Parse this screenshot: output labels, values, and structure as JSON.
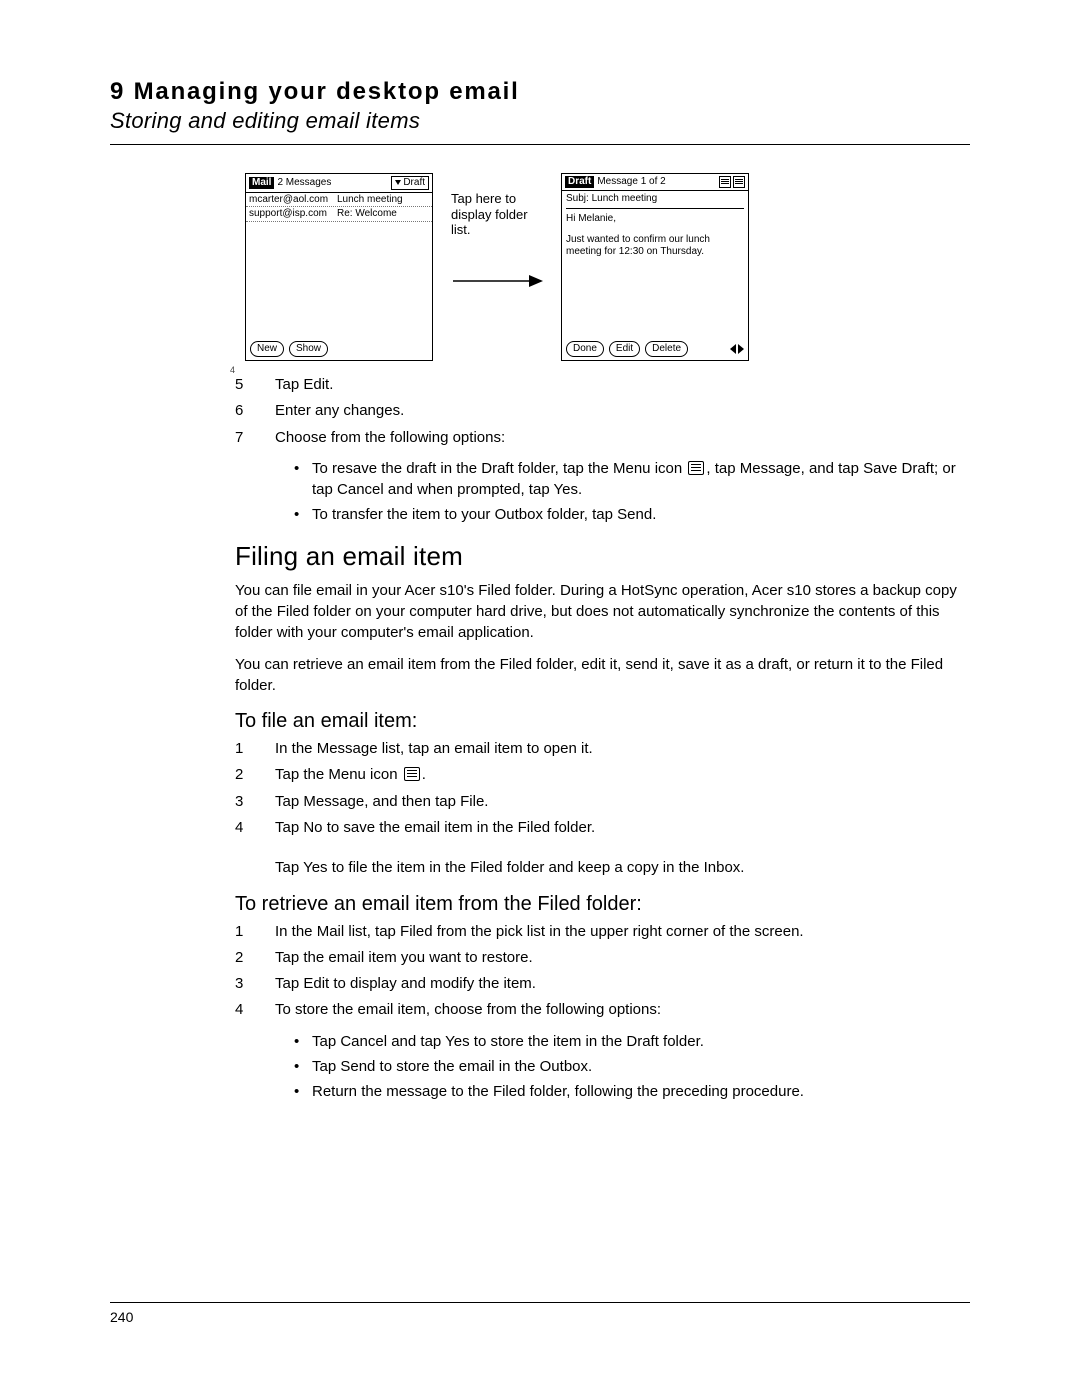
{
  "header": {
    "chapter_number": "9",
    "chapter_title": "Managing your desktop email",
    "section_subtitle": "Storing and editing email items"
  },
  "figure": {
    "callout": "Tap here to display folder list.",
    "left_screen": {
      "app_label": "Mail",
      "messages_count": "2 Messages",
      "folder_selector": "Draft",
      "row1_addr": "mcarter@aol.com",
      "row1_subj": "Lunch meeting",
      "row2_addr": "support@isp.com",
      "row2_subj": "Re: Welcome",
      "btn_new": "New",
      "btn_show": "Show"
    },
    "right_screen": {
      "app_label": "Draft",
      "count": "Message 1 of 2",
      "subj_label": "Subj:",
      "subj_value": "Lunch meeting",
      "greeting": "Hi Melanie,",
      "body": "Just wanted to confirm our lunch meeting for 12:30 on Thursday.",
      "btn_done": "Done",
      "btn_edit": "Edit",
      "btn_delete": "Delete"
    },
    "marker": "4"
  },
  "steps_top": {
    "s5": {
      "n": "5",
      "t": "Tap Edit."
    },
    "s6": {
      "n": "6",
      "t": "Enter any changes."
    },
    "s7": {
      "n": "7",
      "t": "Choose from the following options:"
    }
  },
  "bullets_top": {
    "b1": "To resave the draft in the Draft folder, tap the Menu icon , tap Message, and tap Save Draft; or tap Cancel and when prompted, tap Yes.",
    "b2": "To transfer the item to your Outbox folder, tap Send."
  },
  "section_filing": {
    "title": "Filing an email item",
    "p1": "You can file email in your Acer s10's Filed folder. During a HotSync operation, Acer s10 stores a backup copy of the Filed folder on your computer hard drive, but does not automatically synchronize the contents of this folder with your computer's email application.",
    "p2": "You can retrieve an email item from the Filed folder, edit it, send it, save it as a draft, or return it to the Filed folder."
  },
  "to_file": {
    "title": "To file an email item:",
    "s1": {
      "n": "1",
      "t": "In the Message list, tap an email item to open it."
    },
    "s2": {
      "n": "2",
      "t_pre": "Tap the Menu icon ",
      "t_post": "."
    },
    "s3": {
      "n": "3",
      "t": "Tap Message, and then tap File."
    },
    "s4": {
      "n": "4",
      "t": "Tap No to save the email item in the Filed folder."
    },
    "s4b": "Tap Yes to file the item in the Filed folder and keep a copy in the Inbox."
  },
  "to_retrieve": {
    "title": "To retrieve an email item from the Filed folder:",
    "s1": {
      "n": "1",
      "t": "In the Mail list, tap Filed from the pick list in the upper right corner of the screen."
    },
    "s2": {
      "n": "2",
      "t": "Tap the email item you want to restore."
    },
    "s3": {
      "n": "3",
      "t": "Tap Edit to display and modify the item."
    },
    "s4": {
      "n": "4",
      "t": "To store the email item, choose from the following options:"
    },
    "b1": "Tap Cancel and tap Yes to store the item in the Draft folder.",
    "b2": "Tap Send to store the email in the Outbox.",
    "b3": "Return the message to the Filed folder, following the preceding procedure."
  },
  "footer": {
    "page_number": "240"
  }
}
